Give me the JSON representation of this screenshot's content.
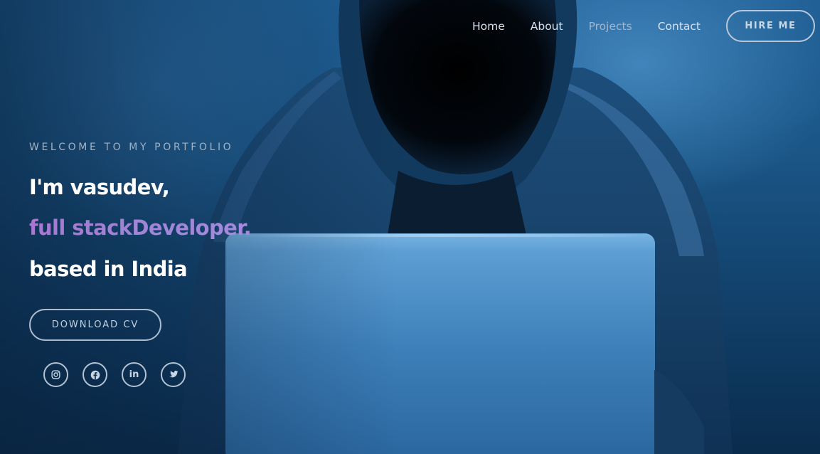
{
  "nav": {
    "links": [
      {
        "label": "Home"
      },
      {
        "label": "About"
      },
      {
        "label": "Projects"
      },
      {
        "label": "Contact"
      }
    ],
    "hire_label": "HIRE ME"
  },
  "hero": {
    "eyebrow": "WELCOME TO MY PORTFOLIO",
    "line1": "I'm vasudev,",
    "line2": "full stackDeveloper.",
    "line3": "based in India",
    "cv_label": "DOWNLOAD CV"
  },
  "socials": [
    {
      "icon": "instagram-icon"
    },
    {
      "icon": "facebook-icon"
    },
    {
      "icon": "linkedin-icon"
    },
    {
      "icon": "twitter-icon"
    }
  ],
  "colors": {
    "accent_gradient_start": "#a877d1",
    "accent_gradient_end": "#a58be0",
    "background": "#1a5586"
  }
}
